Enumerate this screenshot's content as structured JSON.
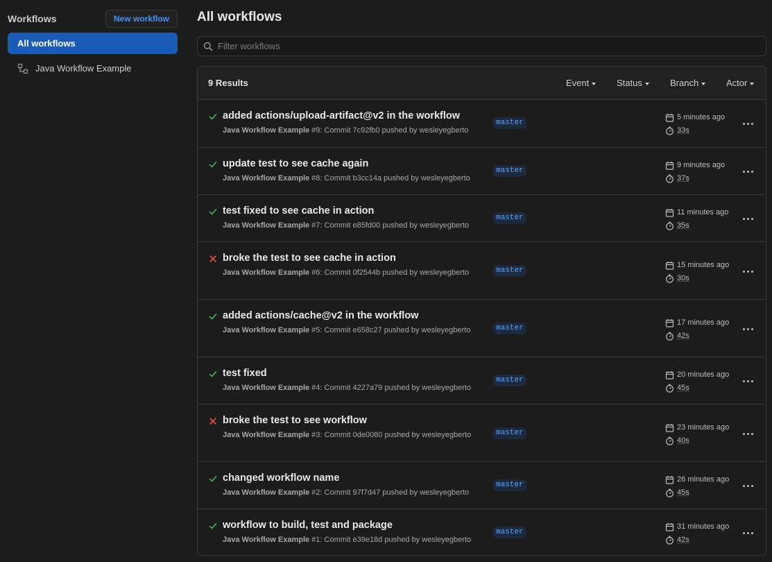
{
  "sidebar": {
    "title": "Workflows",
    "new_workflow_label": "New workflow",
    "active_item": "All workflows",
    "items": [
      {
        "label": "Java Workflow Example",
        "icon": "workflow-icon"
      }
    ]
  },
  "main": {
    "title": "All workflows",
    "filter_placeholder": "Filter workflows",
    "results_label": "9 Results",
    "filters": [
      "Event",
      "Status",
      "Branch",
      "Actor"
    ]
  },
  "colors": {
    "success": "#3fb950",
    "failure": "#f85149",
    "accent": "#1b5bb8",
    "link": "#4493f8"
  },
  "runs": [
    {
      "status": "success",
      "title": "added actions/upload-artifact@v2 in the workflow",
      "workflow": "Java Workflow Example",
      "rest": " #9: Commit 7c92fb0 pushed by wesleyegberto",
      "branch": "master",
      "time_ago": "5 minutes ago",
      "duration": "33s"
    },
    {
      "status": "success",
      "title": "update test to see cache again",
      "workflow": "Java Workflow Example",
      "rest": " #8: Commit b3cc14a pushed by wesleyegberto",
      "branch": "master",
      "time_ago": "9 minutes ago",
      "duration": "37s"
    },
    {
      "status": "success",
      "title": "test fixed to see cache in action",
      "workflow": "Java Workflow Example",
      "rest": " #7: Commit e85fd00 pushed by wesleyegberto",
      "branch": "master",
      "time_ago": "11 minutes ago",
      "duration": "35s"
    },
    {
      "status": "failure",
      "title": "broke the test to see cache in action",
      "workflow": "Java Workflow Example",
      "rest": " #6: Commit 0f2544b pushed by wesleyegberto",
      "branch": "master",
      "time_ago": "15 minutes ago",
      "duration": "30s"
    },
    {
      "status": "success",
      "title": "added actions/cache@v2 in the workflow",
      "workflow": "Java Workflow Example",
      "rest": " #5: Commit e658c27 pushed by wesleyegberto",
      "branch": "master",
      "time_ago": "17 minutes ago",
      "duration": "42s"
    },
    {
      "status": "success",
      "title": "test fixed",
      "workflow": "Java Workflow Example",
      "rest": " #4: Commit 4227a79 pushed by wesleyegberto",
      "branch": "master",
      "time_ago": "20 minutes ago",
      "duration": "45s"
    },
    {
      "status": "failure",
      "title": "broke the test to see workflow",
      "workflow": "Java Workflow Example",
      "rest": " #3: Commit 0de0080 pushed by wesleyegberto",
      "branch": "master",
      "time_ago": "23 minutes ago",
      "duration": "40s"
    },
    {
      "status": "success",
      "title": "changed workflow name",
      "workflow": "Java Workflow Example",
      "rest": " #2: Commit 97f7d47 pushed by wesleyegberto",
      "branch": "master",
      "time_ago": "26 minutes ago",
      "duration": "45s"
    },
    {
      "status": "success",
      "title": "workflow to build, test and package",
      "workflow": "Java Workflow Example",
      "rest": " #1: Commit e39e18d pushed by wesleyegberto",
      "branch": "master",
      "time_ago": "31 minutes ago",
      "duration": "42s"
    }
  ]
}
